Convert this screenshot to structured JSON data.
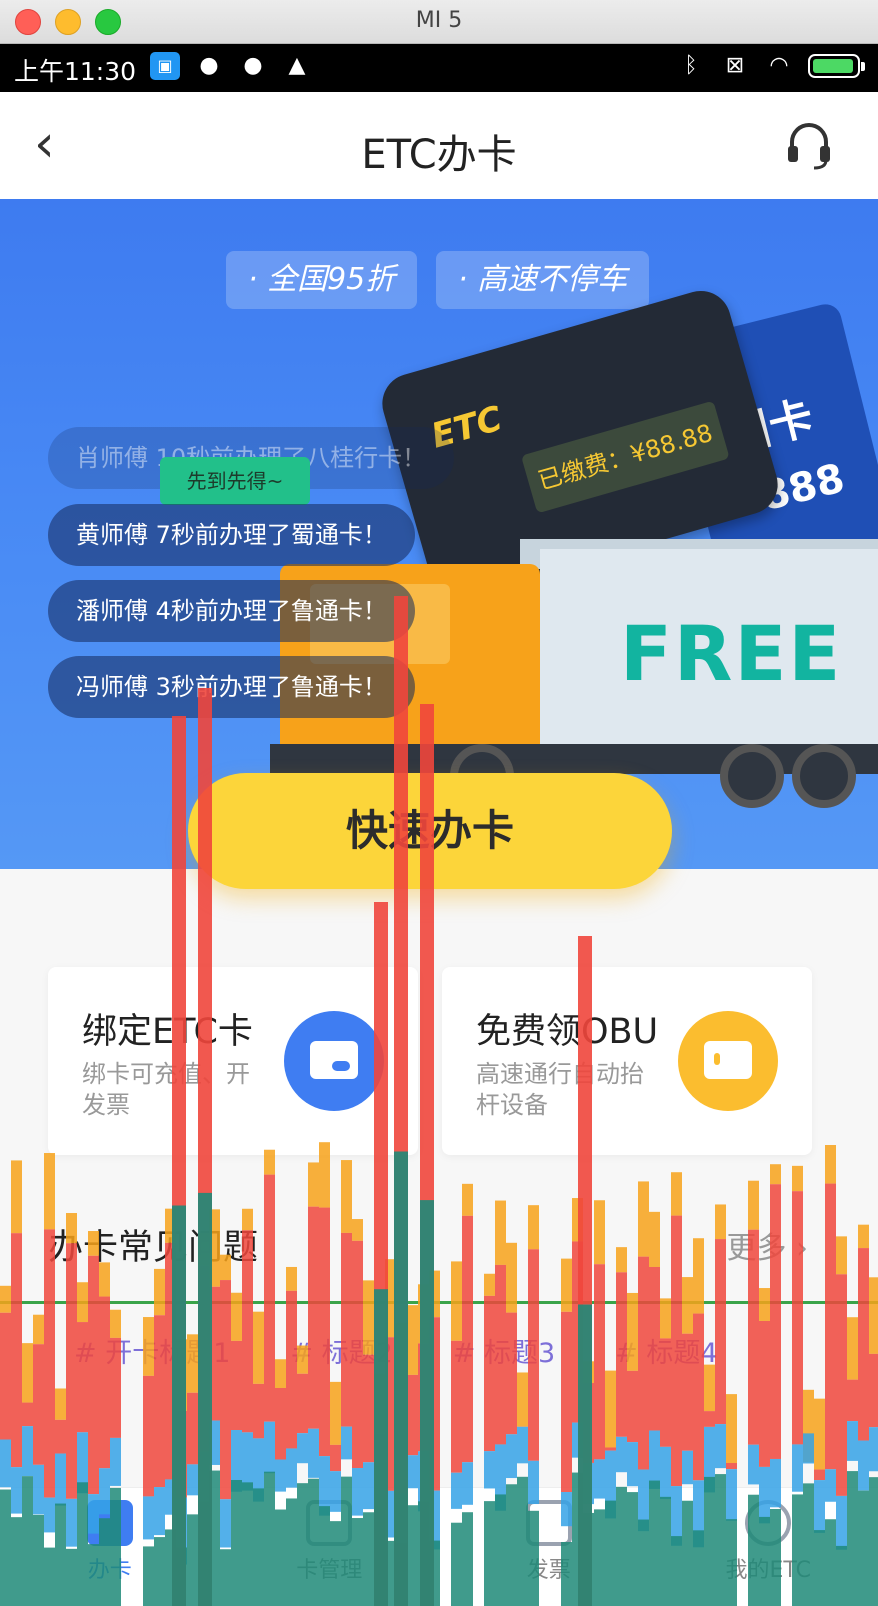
{
  "window": {
    "title": "MI 5"
  },
  "status_bar": {
    "time": "上午11:30",
    "left_icons": [
      "app-icon",
      "cat-icon",
      "cat-icon",
      "warning-icon"
    ],
    "right_icons": [
      "bluetooth-icon",
      "signal-off-icon",
      "wifi-icon",
      "battery-icon"
    ]
  },
  "nav": {
    "title": "ETC办卡",
    "back_icon": "back-arrow-icon",
    "service_icon": "headset-icon"
  },
  "banner": {
    "tags": [
      "· 全国95折",
      "· 高速不停车"
    ],
    "card_text": "国卡",
    "card_number": "888",
    "device_brand": "ETC",
    "device_screen": "已缴费：¥88.88",
    "truck_text": "FREE",
    "toast": "先到先得~",
    "tickers": [
      "肖师傅 10秒前办理了八桂行卡！",
      "黄师傅 7秒前办理了蜀通卡！",
      "潘师傅 4秒前办理了鲁通卡！",
      "冯师傅 3秒前办理了鲁通卡！"
    ]
  },
  "cta": {
    "label": "快速办卡"
  },
  "features": [
    {
      "title": "绑定ETC卡",
      "subtitle": "绑卡可充值、开发票",
      "icon": "card-icon"
    },
    {
      "title": "免费领OBU",
      "subtitle": "高速通行自动抬杆设备",
      "icon": "obu-icon"
    }
  ],
  "faq": {
    "title": "办卡常见问题",
    "more": "更多",
    "tags": [
      "# 开卡标题1",
      "# 标题2",
      "# 标题3",
      "# 标题4"
    ]
  },
  "tabbar": {
    "items": [
      {
        "label": "办卡",
        "icon": "card-tab-icon",
        "active": true
      },
      {
        "label": "卡管理",
        "icon": "grid-tab-icon",
        "active": false
      },
      {
        "label": "发票",
        "icon": "invoice-tab-icon",
        "active": false
      },
      {
        "label": "我的ETC",
        "icon": "user-tab-icon",
        "active": false
      }
    ]
  },
  "colors": {
    "accent_blue": "#3f7df2",
    "cta_yellow": "#fcd53a",
    "overlay_red": "#f0463c",
    "overlay_orange": "#f7a21a",
    "overlay_teal": "#1f8a78",
    "overlay_blue": "#35a2e6"
  }
}
